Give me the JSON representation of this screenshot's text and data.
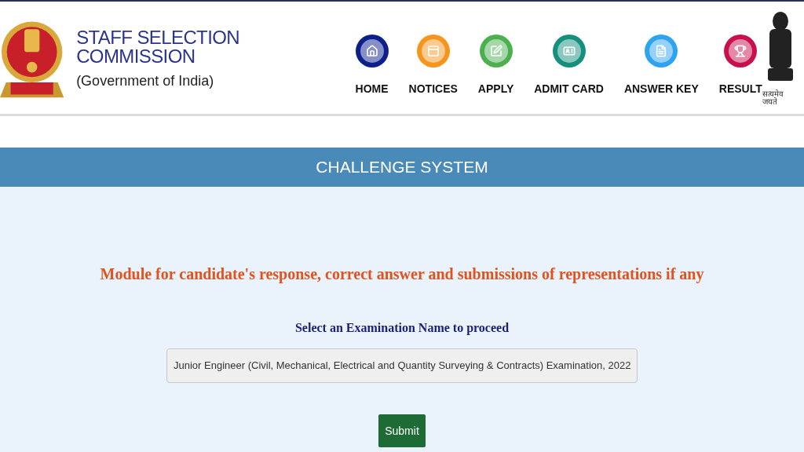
{
  "header": {
    "title": "STAFF SELECTION COMMISSION",
    "subtitle": "(Government of India)",
    "emblem_motto": "सत्यमेव जयते"
  },
  "nav": [
    {
      "label": "HOME",
      "kind": "home",
      "color": "#0d1f8c"
    },
    {
      "label": "NOTICES",
      "kind": "notices",
      "color": "#f7941d"
    },
    {
      "label": "APPLY",
      "kind": "apply",
      "color": "#4caf50"
    },
    {
      "label": "ADMIT CARD",
      "kind": "admit",
      "color": "#15907d"
    },
    {
      "label": "ANSWER KEY",
      "kind": "answer",
      "color": "#2ea3f2"
    },
    {
      "label": "RESULT",
      "kind": "result",
      "color": "#c8104e"
    }
  ],
  "banner": {
    "title": "CHALLENGE SYSTEM"
  },
  "main": {
    "heading": "Module for candidate's response, correct answer and submissions of representations if any",
    "select_label": "Select an Examination Name to proceed",
    "exam_select": {
      "value": "Junior Engineer (Civil, Mechanical, Electrical and Quantity Surveying & Contracts) Examination, 2022"
    },
    "submit": "Submit"
  }
}
